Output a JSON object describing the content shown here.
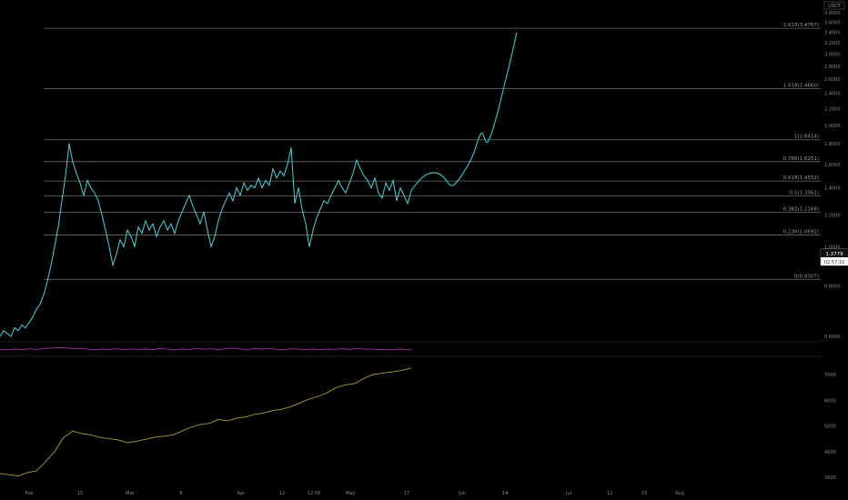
{
  "currency_label": "USDT",
  "last_price": "1.3779",
  "countdown": "02:57:10",
  "colors": {
    "background": "#000000",
    "price_line": "#4fd1d9",
    "projection": "#3ec9c9",
    "rsi_line": "#a32ea7",
    "volume_line": "#a79a2c",
    "fib_line": "#6c6c6c",
    "price_tag": "#ffffff"
  },
  "chart_data": [
    {
      "type": "line",
      "name": "price",
      "y_scale": "log",
      "y_ticks": [
        "3.8000",
        "3.6000",
        "3.4000",
        "3.2000",
        "3.0000",
        "2.8000",
        "2.6000",
        "2.4000",
        "2.2000",
        "2.0000",
        "1.8000",
        "1.6000",
        "1.4000",
        "1.2000",
        "1.0000",
        "0.8000",
        "0.6000"
      ],
      "x_ticks": [
        "Feb",
        "15",
        "Mar",
        "8",
        "Apr",
        "12",
        "12:00",
        "May",
        "17",
        "Jun",
        "14",
        "Jul",
        "12",
        "23",
        "Aug"
      ],
      "fib_levels": [
        {
          "label": "2.618(3.4767)",
          "value": 3.4767
        },
        {
          "label": "1.618(2.4660)",
          "value": 2.466
        },
        {
          "label": "1(1.8414)",
          "value": 1.8414
        },
        {
          "label": "0.786(1.6251)",
          "value": 1.6251
        },
        {
          "label": "0.618(1.4553)",
          "value": 1.4553
        },
        {
          "label": "0.5(1.3361)",
          "value": 1.3361
        },
        {
          "label": "0.382(1.2168)",
          "value": 1.2168
        },
        {
          "label": "0.236(1.0692)",
          "value": 1.0692
        },
        {
          "label": "0(0.8307)",
          "value": 0.8307
        }
      ],
      "series": [
        {
          "key": "history",
          "x": [
            0,
            4,
            8,
            12,
            16,
            20,
            24,
            28,
            32,
            36,
            40,
            44,
            48,
            52,
            56,
            60,
            64,
            68,
            72,
            76,
            80,
            84,
            88,
            92,
            96,
            100,
            104,
            108,
            112,
            116,
            120,
            124,
            128,
            132,
            136,
            140,
            144,
            148,
            152,
            156,
            160,
            164,
            168,
            172,
            176,
            180,
            184,
            188,
            192,
            196,
            200,
            204,
            208,
            212,
            216,
            220,
            224,
            228,
            232,
            236,
            240,
            244,
            248,
            252,
            256,
            260,
            264,
            268,
            272,
            276,
            280,
            284,
            288,
            292,
            296,
            300,
            304,
            308,
            312,
            316,
            320,
            324,
            328,
            332,
            336,
            340,
            344,
            348,
            352,
            356,
            360,
            364,
            368,
            372,
            376,
            380,
            384,
            388,
            392,
            396,
            400,
            404,
            408,
            412,
            416,
            420,
            424,
            428,
            432,
            436,
            440,
            444,
            448,
            452
          ],
          "y": [
            0.6,
            0.62,
            0.61,
            0.6,
            0.63,
            0.62,
            0.64,
            0.63,
            0.65,
            0.67,
            0.7,
            0.72,
            0.76,
            0.82,
            0.9,
            1.0,
            1.12,
            1.3,
            1.5,
            1.8,
            1.62,
            1.52,
            1.44,
            1.34,
            1.46,
            1.4,
            1.36,
            1.3,
            1.2,
            1.1,
            1.0,
            0.9,
            0.96,
            1.04,
            1.0,
            1.1,
            1.06,
            1.0,
            1.12,
            1.08,
            1.16,
            1.1,
            1.14,
            1.06,
            1.12,
            1.16,
            1.1,
            1.14,
            1.08,
            1.16,
            1.22,
            1.28,
            1.34,
            1.26,
            1.2,
            1.14,
            1.22,
            1.1,
            1.0,
            1.06,
            1.16,
            1.24,
            1.3,
            1.36,
            1.3,
            1.4,
            1.34,
            1.44,
            1.38,
            1.42,
            1.4,
            1.48,
            1.4,
            1.46,
            1.42,
            1.56,
            1.48,
            1.54,
            1.5,
            1.6,
            1.76,
            1.28,
            1.4,
            1.24,
            1.14,
            1.0,
            1.1,
            1.18,
            1.24,
            1.3,
            1.28,
            1.34,
            1.4,
            1.46,
            1.4,
            1.36,
            1.44,
            1.52,
            1.64,
            1.56,
            1.5,
            1.46,
            1.4,
            1.48,
            1.36,
            1.32,
            1.44,
            1.38,
            1.46,
            1.3,
            1.4,
            1.34,
            1.28,
            1.3779
          ]
        },
        {
          "key": "projection",
          "x": [
            452,
            460,
            470,
            480,
            488,
            496,
            504,
            512,
            520,
            526,
            530,
            534,
            538,
            546,
            554,
            562,
            568
          ],
          "y": [
            1.3779,
            1.46,
            1.52,
            1.53,
            1.49,
            1.4,
            1.46,
            1.56,
            1.68,
            1.86,
            1.94,
            1.8,
            1.84,
            2.1,
            2.5,
            2.95,
            3.4
          ]
        }
      ]
    },
    {
      "type": "line",
      "name": "rsi",
      "x": [
        0,
        8,
        16,
        24,
        32,
        40,
        48,
        56,
        64,
        72,
        80,
        88,
        96,
        104,
        112,
        120,
        128,
        136,
        144,
        152,
        160,
        168,
        176,
        184,
        192,
        200,
        208,
        216,
        224,
        232,
        240,
        248,
        256,
        264,
        272,
        280,
        288,
        296,
        304,
        312,
        320,
        328,
        336,
        344,
        352,
        360,
        368,
        376,
        384,
        392,
        400,
        408,
        416,
        424,
        432,
        440,
        448,
        452
      ],
      "y": [
        48,
        44,
        50,
        46,
        52,
        47,
        54,
        58,
        62,
        60,
        52,
        56,
        49,
        45,
        50,
        47,
        53,
        46,
        51,
        48,
        50,
        46,
        54,
        49,
        45,
        51,
        47,
        55,
        49,
        52,
        46,
        53,
        58,
        51,
        47,
        54,
        50,
        56,
        48,
        46,
        52,
        49,
        47,
        51,
        45,
        50,
        48,
        53,
        47,
        55,
        49,
        51,
        46,
        48,
        44,
        50,
        47,
        49
      ]
    },
    {
      "type": "line",
      "name": "volume",
      "y_ticks": [
        "7000",
        "6000",
        "5000",
        "4000",
        "3000"
      ],
      "x": [
        0,
        10,
        20,
        30,
        40,
        50,
        60,
        70,
        80,
        90,
        100,
        110,
        120,
        130,
        140,
        150,
        160,
        170,
        180,
        190,
        200,
        210,
        220,
        230,
        240,
        250,
        260,
        270,
        280,
        290,
        300,
        310,
        320,
        330,
        340,
        350,
        360,
        370,
        380,
        390,
        400,
        410,
        420,
        430,
        440,
        452
      ],
      "y": [
        3150,
        3100,
        3050,
        3180,
        3250,
        3600,
        4000,
        4550,
        4800,
        4700,
        4650,
        4550,
        4500,
        4450,
        4350,
        4400,
        4480,
        4560,
        4600,
        4650,
        4800,
        4950,
        5050,
        5100,
        5250,
        5200,
        5300,
        5350,
        5450,
        5500,
        5600,
        5650,
        5750,
        5900,
        6050,
        6150,
        6300,
        6500,
        6600,
        6650,
        6850,
        7000,
        7050,
        7100,
        7150,
        7250
      ]
    }
  ]
}
